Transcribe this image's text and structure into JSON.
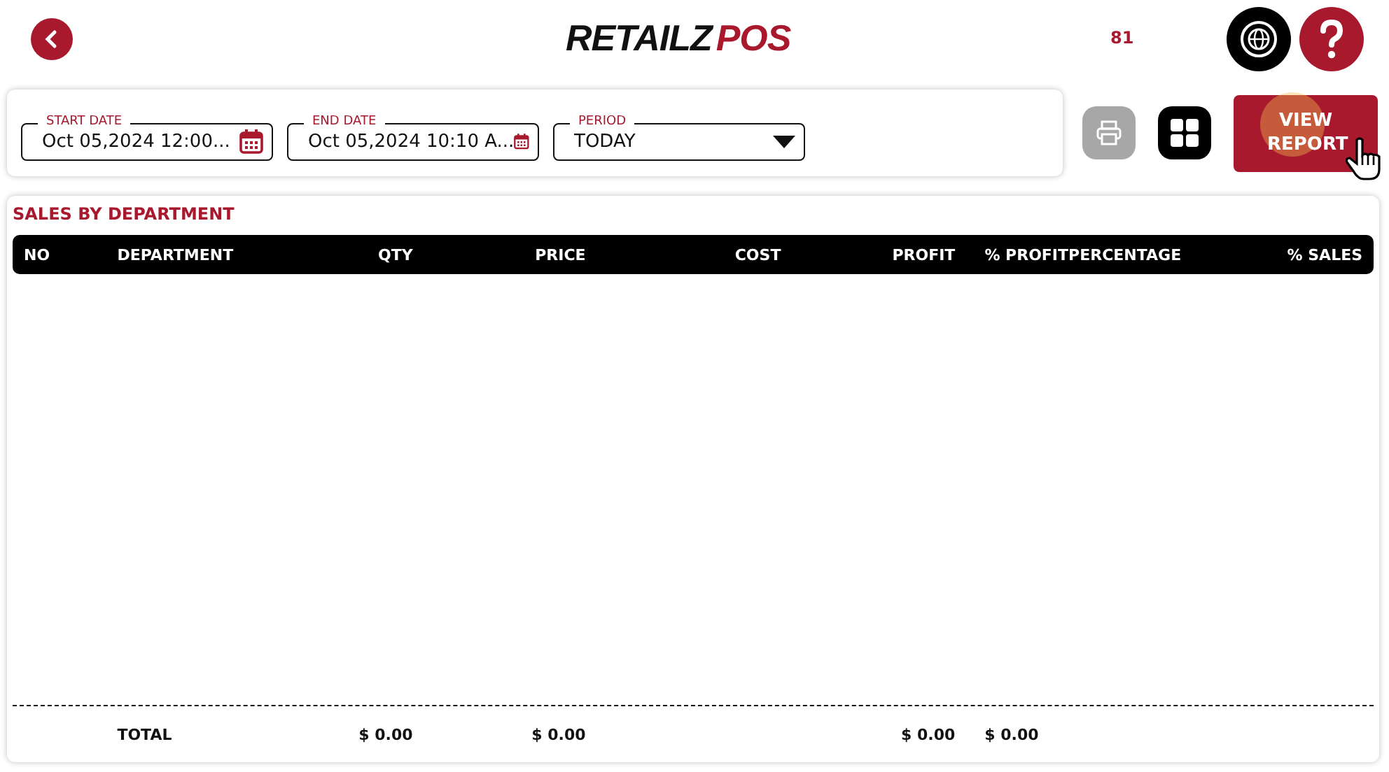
{
  "header": {
    "logo": {
      "primary": "RETAILZ",
      "accent": "POS"
    },
    "counter": "81"
  },
  "filters": [
    {
      "label": "START DATE",
      "value": "Oct 05,2024 12:00...",
      "kind": "date"
    },
    {
      "label": "END DATE",
      "value": "Oct 05,2024 10:10 A...",
      "kind": "date"
    },
    {
      "label": "PERIOD",
      "value": "TODAY",
      "kind": "select"
    }
  ],
  "actions": {
    "print_disabled": true,
    "view_report": "VIEW REPORT"
  },
  "report": {
    "title": "SALES BY DEPARTMENT",
    "columns": [
      "NO",
      "DEPARTMENT",
      "QTY",
      "PRICE",
      "COST",
      "PROFIT",
      "% PROFITPERCENTAGE",
      "% SALES"
    ],
    "totals": {
      "label": "TOTAL",
      "qty": "$ 0.00",
      "price": "$ 0.00",
      "profit": "$ 0.00",
      "profit_percentage": "$ 0.00"
    }
  }
}
